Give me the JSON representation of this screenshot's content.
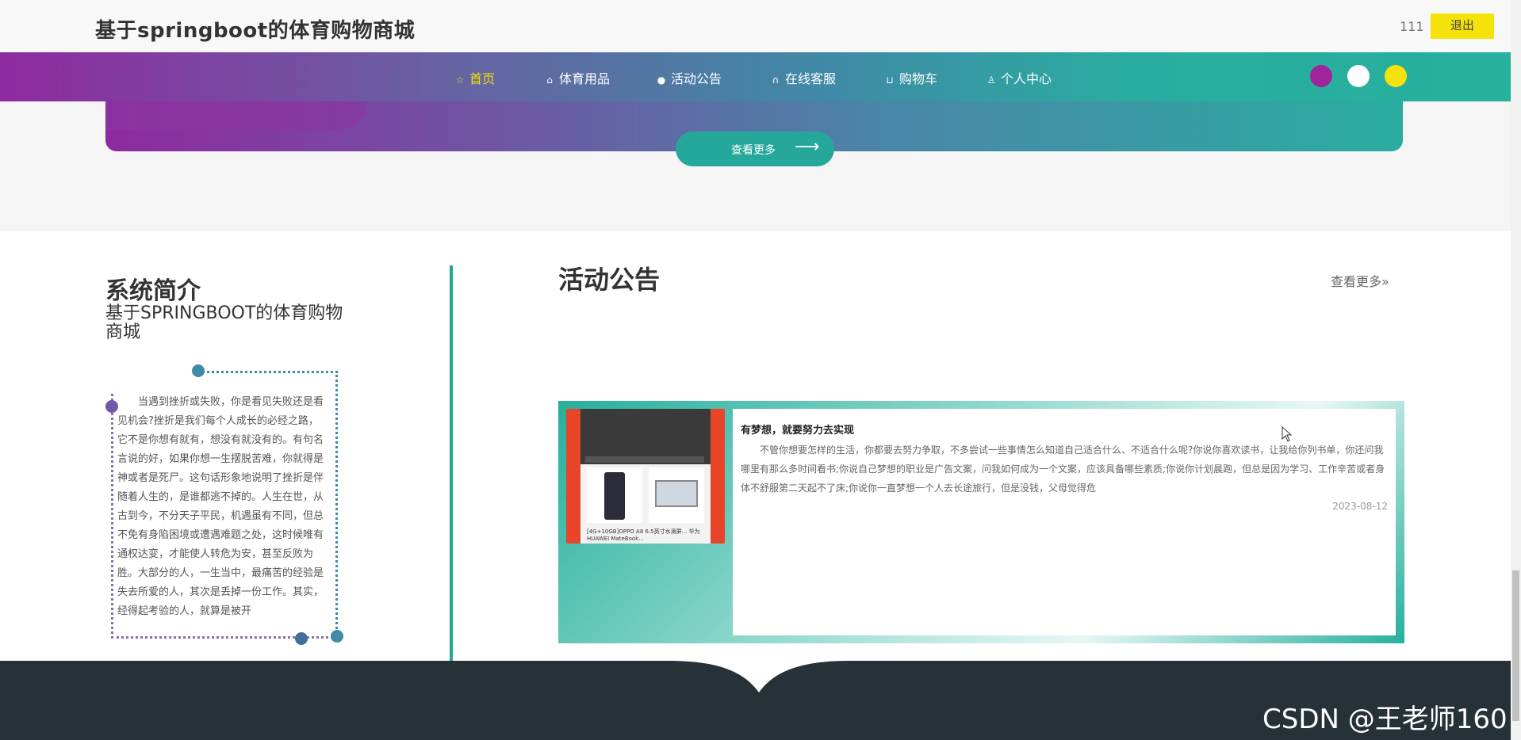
{
  "header": {
    "site_title": "基于springboot的体育购物商城",
    "user": "111",
    "logout_label": "退出"
  },
  "nav": {
    "items": [
      {
        "label": "首页",
        "icon": "star-icon",
        "glyph": "☆",
        "active": true
      },
      {
        "label": "体育用品",
        "icon": "bag-icon",
        "glyph": "⌂"
      },
      {
        "label": "活动公告",
        "icon": "info-icon",
        "glyph": "●"
      },
      {
        "label": "在线客服",
        "icon": "headset-icon",
        "glyph": "∩"
      },
      {
        "label": "购物车",
        "icon": "cart-icon",
        "glyph": "⊔"
      },
      {
        "label": "个人中心",
        "icon": "user-icon",
        "glyph": "♙"
      }
    ],
    "theme_colors": [
      "#a0249c",
      "#ffffff",
      "#f5e20a"
    ]
  },
  "banner": {
    "more_label": "查看更多",
    "more_arrow": "⟶"
  },
  "intro": {
    "title": "系统简介",
    "subtitle": "基于SPRINGBOOT的体育购物商城",
    "text": "当遇到挫折或失败，你是看见失败还是看见机会?挫折是我们每个人成长的必经之路，它不是你想有就有，想没有就没有的。有句名言说的好，如果你想一生摆脱苦难，你就得是神或者是死尸。这句话形象地说明了挫折是伴随着人生的，是谁都逃不掉的。人生在世，从古到今，不分天子平民，机遇虽有不同，但总不免有身陷困境或遭遇难题之处，这时候唯有通权达变，才能使人转危为安，甚至反败为胜。大部分的人，一生当中，最痛苦的经验是失去所爱的人，其次是丢掉一份工作。其实，经得起考验的人，就算是被开"
  },
  "news": {
    "title": "活动公告",
    "more_label": "查看更多»",
    "item": {
      "headline": "有梦想，就要努力去实现",
      "desc": "不管你想要怎样的生活，你都要去努力争取，不多尝试一些事情怎么知道自己适合什么、不适合什么呢?你说你喜欢读书，让我给你列书单，你还问我哪里有那么多时间看书;你说自己梦想的职业是广告文案，问我如何成为一个文案，应该具备哪些素质;你说你计划晨跑，但总是因为学习、工作辛苦或者身体不舒服第二天起不了床;你说你一直梦想一个人去长途旅行，但是没钱，父母觉得危",
      "date": "2023-08-12",
      "image_caption": "[4G+10GB]OPPO A8 6.5英寸水滴屏...   华为HUAWEI MateBook..."
    }
  },
  "watermark": "CSDN @王老师160"
}
